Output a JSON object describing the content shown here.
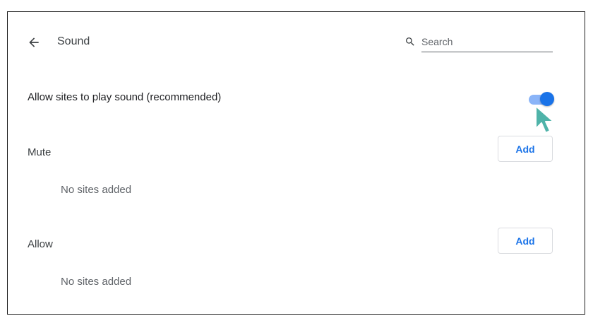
{
  "header": {
    "title": "Sound",
    "back_icon": "arrow-back-icon",
    "search": {
      "placeholder": "Search",
      "value": "",
      "icon": "search-icon"
    }
  },
  "sound_setting": {
    "label": "Allow sites to play sound (recommended)",
    "enabled": true
  },
  "mute_section": {
    "title": "Mute",
    "add_label": "Add",
    "empty_text": "No sites added"
  },
  "allow_section": {
    "title": "Allow",
    "add_label": "Add",
    "empty_text": "No sites added"
  },
  "colors": {
    "accent": "#1a73e8",
    "toggle_track": "#8ab4f8",
    "cursor": "#4fb3a9"
  }
}
